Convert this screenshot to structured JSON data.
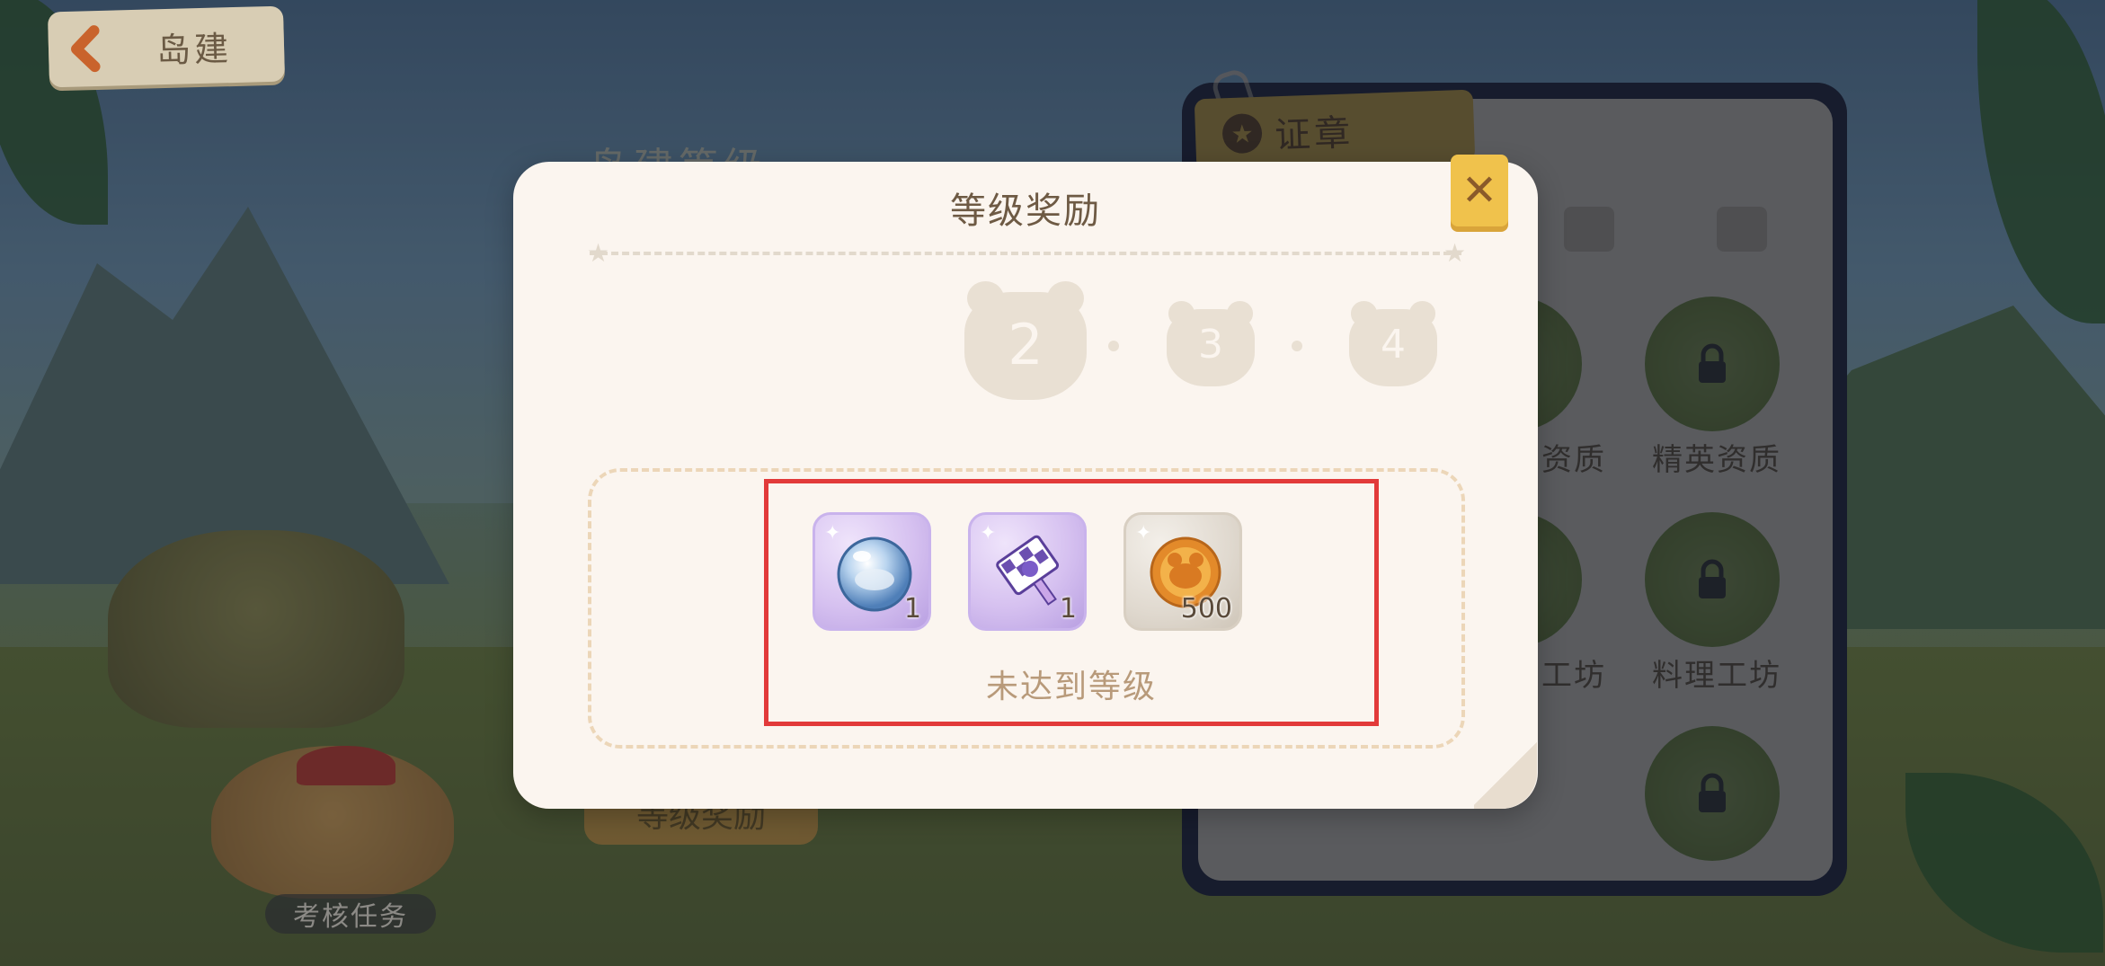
{
  "header": {
    "back_label": "岛建"
  },
  "background": {
    "under_title": "岛建等级",
    "under_button": "等级奖励",
    "task_label": "考核任务",
    "badge_panel": {
      "tab_label": "证章",
      "cells": [
        {
          "label": "资质"
        },
        {
          "label": "精英资质"
        },
        {
          "label": "工坊"
        },
        {
          "label": "料理工坊"
        }
      ]
    }
  },
  "modal": {
    "title": "等级奖励",
    "levels": [
      {
        "number": "2"
      },
      {
        "number": "3"
      },
      {
        "number": "4"
      }
    ],
    "rewards": [
      {
        "name": "bubble-orb",
        "quantity": "1"
      },
      {
        "name": "purple-ticket",
        "quantity": "1"
      },
      {
        "name": "bear-coin",
        "quantity": "500"
      }
    ],
    "status": "未达到等级"
  },
  "colors": {
    "modal_bg": "#fbf5ef",
    "title": "#6e5a44",
    "close_button": "#f0c24c",
    "highlight": "#e23a3a",
    "status_text": "#b89a7a"
  }
}
